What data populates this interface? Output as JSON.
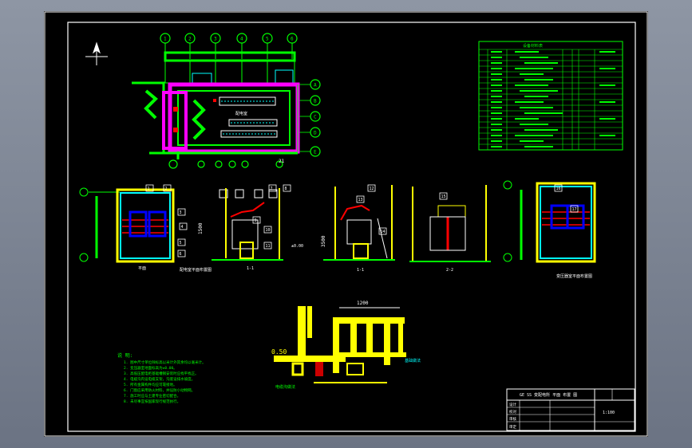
{
  "title_block": {
    "drawing_title": "GE SS 变配电所 平面 布置 图",
    "rows": [
      "设计",
      "校对",
      "审核",
      "审定"
    ],
    "scale": "1:100"
  },
  "legend_table": {
    "header": "设备材料表",
    "rows": 18
  },
  "plan": {
    "axis_top": [
      "1",
      "2",
      "3",
      "4",
      "5",
      "6"
    ],
    "axis_right": [
      "A",
      "B",
      "C",
      "D",
      "E"
    ],
    "room_label": "配电室",
    "dim_label": "21"
  },
  "sections": {
    "left_label": "平面",
    "mid_caption": "配电室平面布置图",
    "s1": "1-1",
    "s2": "1-1",
    "s3": "2-2",
    "right_label": "平面",
    "right_caption": "变压器室平面布置图",
    "level_tag": "±0.00",
    "callouts": [
      "1",
      "2",
      "3",
      "4",
      "5",
      "6",
      "7",
      "8",
      "9",
      "10",
      "11",
      "12",
      "13",
      "14",
      "15",
      "16",
      "17"
    ]
  },
  "detail": {
    "elev_label": "0.50",
    "width_label": "1200",
    "bottom_note": "电缆沟做法",
    "side_note": "基础做法"
  },
  "notes": {
    "heading": "说 明:",
    "lines": [
      "1. 图中尺寸单位除标高以米计外其余均以毫米计。",
      "2. 变压器室地面标高为±0.00。",
      "3. 高低压配电柜基础槽钢安装时应找平找正。",
      "4. 电缆沟内设电缆支架，沟底设排水坡度。",
      "5. 所有金属构件均应可靠接地。",
      "6. 门窗应采用防火材料，并设防小动物网。",
      "7. 施工时应与土建专业密切配合。",
      "8. 未尽事宜按国家现行规范执行。"
    ]
  }
}
